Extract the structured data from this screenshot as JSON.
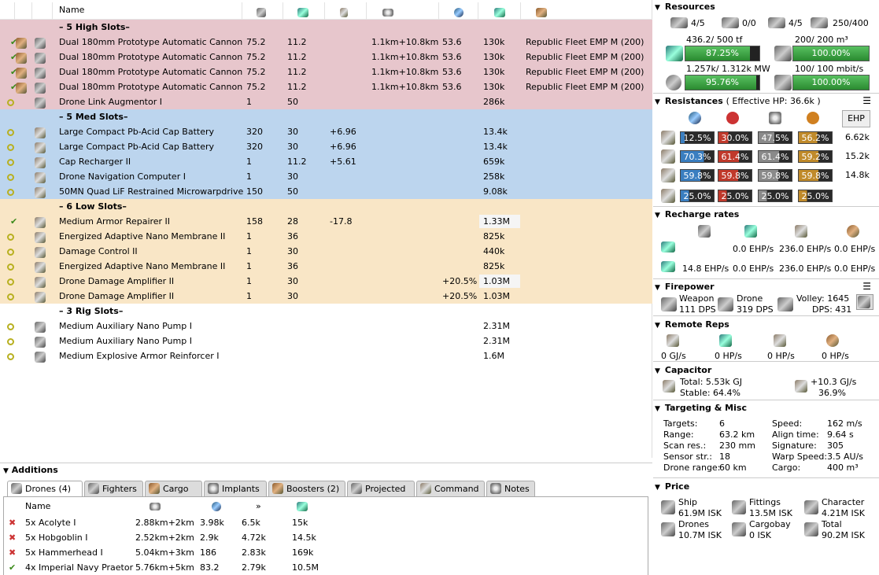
{
  "fitting": {
    "columns": {
      "name": "Name"
    },
    "racks": [
      {
        "label": "– 5 High Slots–",
        "kind": "high",
        "rows": [
          {
            "state": "on",
            "charge": true,
            "name": "Dual 180mm Prototype Automatic Cannon",
            "c1": "75.2",
            "c2": "11.2",
            "c3": "",
            "c4": "1.1km+10.8km",
            "c5": "53.6",
            "c6": "130k",
            "c7": "Republic Fleet EMP M (200)"
          },
          {
            "state": "on",
            "charge": true,
            "name": "Dual 180mm Prototype Automatic Cannon",
            "c1": "75.2",
            "c2": "11.2",
            "c3": "",
            "c4": "1.1km+10.8km",
            "c5": "53.6",
            "c6": "130k",
            "c7": "Republic Fleet EMP M (200)"
          },
          {
            "state": "on",
            "charge": true,
            "name": "Dual 180mm Prototype Automatic Cannon",
            "c1": "75.2",
            "c2": "11.2",
            "c3": "",
            "c4": "1.1km+10.8km",
            "c5": "53.6",
            "c6": "130k",
            "c7": "Republic Fleet EMP M (200)"
          },
          {
            "state": "on",
            "charge": true,
            "name": "Dual 180mm Prototype Automatic Cannon",
            "c1": "75.2",
            "c2": "11.2",
            "c3": "",
            "c4": "1.1km+10.8km",
            "c5": "53.6",
            "c6": "130k",
            "c7": "Republic Fleet EMP M (200)"
          },
          {
            "state": "passive",
            "charge": false,
            "name": "Drone Link Augmentor I",
            "c1": "1",
            "c2": "50",
            "c3": "",
            "c4": "",
            "c5": "",
            "c6": "286k",
            "c7": ""
          }
        ]
      },
      {
        "label": "– 5 Med Slots–",
        "kind": "med",
        "rows": [
          {
            "state": "passive",
            "name": "Large Compact Pb-Acid Cap Battery",
            "c1": "320",
            "c2": "30",
            "c3": "+6.96",
            "c4": "",
            "c5": "",
            "c6": "13.4k",
            "c7": ""
          },
          {
            "state": "passive",
            "name": "Large Compact Pb-Acid Cap Battery",
            "c1": "320",
            "c2": "30",
            "c3": "+6.96",
            "c4": "",
            "c5": "",
            "c6": "13.4k",
            "c7": ""
          },
          {
            "state": "passive",
            "name": "Cap Recharger II",
            "c1": "1",
            "c2": "11.2",
            "c3": "+5.61",
            "c4": "",
            "c5": "",
            "c6": "659k",
            "c7": ""
          },
          {
            "state": "passive",
            "name": "Drone Navigation Computer I",
            "c1": "1",
            "c2": "30",
            "c3": "",
            "c4": "",
            "c5": "",
            "c6": "258k",
            "c7": ""
          },
          {
            "state": "passive",
            "name": "50MN Quad LiF Restrained Microwarpdrive",
            "c1": "150",
            "c2": "50",
            "c3": "",
            "c4": "",
            "c5": "",
            "c6": "9.08k",
            "c7": ""
          }
        ]
      },
      {
        "label": "– 6 Low Slots–",
        "kind": "low",
        "rows": [
          {
            "state": "on",
            "name": "Medium Armor Repairer II",
            "c1": "158",
            "c2": "28",
            "c3": "-17.8",
            "c4": "",
            "c5": "",
            "c6": "1.33M",
            "c7": "",
            "hl": true
          },
          {
            "state": "passive",
            "name": "Energized Adaptive Nano Membrane II",
            "c1": "1",
            "c2": "36",
            "c3": "",
            "c4": "",
            "c5": "",
            "c6": "825k",
            "c7": ""
          },
          {
            "state": "passive",
            "name": "Damage Control II",
            "c1": "1",
            "c2": "30",
            "c3": "",
            "c4": "",
            "c5": "",
            "c6": "440k",
            "c7": ""
          },
          {
            "state": "passive",
            "name": "Energized Adaptive Nano Membrane II",
            "c1": "1",
            "c2": "36",
            "c3": "",
            "c4": "",
            "c5": "",
            "c6": "825k",
            "c7": ""
          },
          {
            "state": "passive",
            "name": "Drone Damage Amplifier II",
            "c1": "1",
            "c2": "30",
            "c3": "",
            "c4": "",
            "c5": "+20.5%",
            "c6": "1.03M",
            "c7": "",
            "hl": true
          },
          {
            "state": "passive",
            "name": "Drone Damage Amplifier II",
            "c1": "1",
            "c2": "30",
            "c3": "",
            "c4": "",
            "c5": "+20.5%",
            "c6": "1.03M",
            "c7": ""
          }
        ]
      },
      {
        "label": "– 3 Rig Slots–",
        "kind": "rig",
        "rows": [
          {
            "state": "passive",
            "name": "Medium Auxiliary Nano Pump I",
            "c1": "",
            "c2": "",
            "c3": "",
            "c4": "",
            "c5": "",
            "c6": "2.31M",
            "c7": ""
          },
          {
            "state": "passive",
            "name": "Medium Auxiliary Nano Pump I",
            "c1": "",
            "c2": "",
            "c3": "",
            "c4": "",
            "c5": "",
            "c6": "2.31M",
            "c7": ""
          },
          {
            "state": "passive",
            "name": "Medium Explosive Armor Reinforcer I",
            "c1": "",
            "c2": "",
            "c3": "",
            "c4": "",
            "c5": "",
            "c6": "1.6M",
            "c7": ""
          }
        ]
      }
    ]
  },
  "additions": {
    "title": "Additions",
    "tabs": [
      "Drones (4)",
      "Fighters",
      "Cargo",
      "Implants",
      "Boosters (2)",
      "Projected",
      "Command",
      "Notes"
    ],
    "drone_header": "Name",
    "drones": [
      {
        "active": false,
        "name": "5x Acolyte I",
        "range": "2.88km+2km",
        "dps": "3.98k",
        "speed": "6.5k",
        "price": "15k"
      },
      {
        "active": false,
        "name": "5x Hobgoblin I",
        "range": "2.52km+2km",
        "dps": "2.9k",
        "speed": "4.72k",
        "price": "14.5k"
      },
      {
        "active": false,
        "name": "5x Hammerhead I",
        "range": "5.04km+3km",
        "dps": "186",
        "speed": "2.83k",
        "price": "169k"
      },
      {
        "active": true,
        "name": "4x Imperial Navy Praetor",
        "range": "5.76km+5km",
        "dps": "83.2",
        "speed": "2.79k",
        "price": "10.5M"
      }
    ]
  },
  "resources": {
    "title": "Resources",
    "top": [
      "4/5",
      "0/0",
      "4/5",
      "250/400"
    ],
    "cpu": {
      "label": "436.2/ 500 tf",
      "pct": "87.25%",
      "val": 87.25
    },
    "drone_bay": {
      "label": "200/ 200 m³",
      "pct": "100.00%",
      "val": 100
    },
    "pg": {
      "label": "1.257k/ 1.312k MW",
      "pct": "95.76%",
      "val": 95.76
    },
    "bandwidth": {
      "label": "100/ 100 mbit/s",
      "pct": "100.00%",
      "val": 100
    }
  },
  "resistances": {
    "title": "Resistances",
    "ehp_title": "( Effective HP: 36.6k )",
    "ehp_button": "EHP",
    "rows": [
      {
        "vals": [
          "12.5%",
          "30.0%",
          "47.5%",
          "56.2%"
        ],
        "fill": [
          12.5,
          30.0,
          47.5,
          56.2
        ],
        "ehp": "6.62k"
      },
      {
        "vals": [
          "70.3%",
          "61.4%",
          "61.4%",
          "59.2%"
        ],
        "fill": [
          70.3,
          61.4,
          61.4,
          59.2
        ],
        "ehp": "15.2k"
      },
      {
        "vals": [
          "59.8%",
          "59.8%",
          "59.8%",
          "59.8%"
        ],
        "fill": [
          59.8,
          59.8,
          59.8,
          59.8
        ],
        "ehp": "14.8k"
      },
      {
        "vals": [
          "25.0%",
          "25.0%",
          "25.0%",
          "25.0%"
        ],
        "fill": [
          25,
          25,
          25,
          25
        ],
        "ehp": ""
      }
    ],
    "colors": [
      "#3a7ec0",
      "#c0392b",
      "#8a8a8a",
      "#c08a2a"
    ]
  },
  "recharge": {
    "title": "Recharge rates",
    "row1": [
      "0.0 EHP/s",
      "236.0 EHP/s",
      "0.0 EHP/s"
    ],
    "row2": [
      "14.8 EHP/s",
      "0.0 EHP/s",
      "236.0 EHP/s",
      "0.0 EHP/s"
    ]
  },
  "firepower": {
    "title": "Firepower",
    "weapon_label": "Weapon",
    "weapon_dps": "111 DPS",
    "drone_label": "Drone",
    "drone_dps": "319 DPS",
    "volley": "Volley: 1645",
    "dps": "DPS: 431"
  },
  "remote": {
    "title": "Remote Reps",
    "vals": [
      "0 GJ/s",
      "0 HP/s",
      "0 HP/s",
      "0 HP/s"
    ]
  },
  "capacitor": {
    "title": "Capacitor",
    "total": "Total: 5.53k GJ",
    "stable": "Stable: 64.4%",
    "delta": "+10.3 GJ/s",
    "pct": "36.9%"
  },
  "targeting": {
    "title": "Targeting & Misc",
    "left": [
      [
        "Targets:",
        "6"
      ],
      [
        "Range:",
        "63.2 km"
      ],
      [
        "Scan res.:",
        "230 mm"
      ],
      [
        "Sensor str.:",
        "18"
      ],
      [
        "Drone range:",
        "60 km"
      ]
    ],
    "right": [
      [
        "Speed:",
        "162 m/s"
      ],
      [
        "Align time:",
        "9.64 s"
      ],
      [
        "Signature:",
        "305"
      ],
      [
        "Warp Speed:",
        "3.5 AU/s"
      ],
      [
        "Cargo:",
        "400 m³"
      ]
    ]
  },
  "price": {
    "title": "Price",
    "items": [
      [
        "Ship",
        "61.9M ISK"
      ],
      [
        "Fittings",
        "13.5M ISK"
      ],
      [
        "Character",
        "4.21M ISK"
      ],
      [
        "Drones",
        "10.7M ISK"
      ],
      [
        "Cargobay",
        "0 ISK"
      ],
      [
        "Total",
        "90.2M ISK"
      ]
    ]
  }
}
